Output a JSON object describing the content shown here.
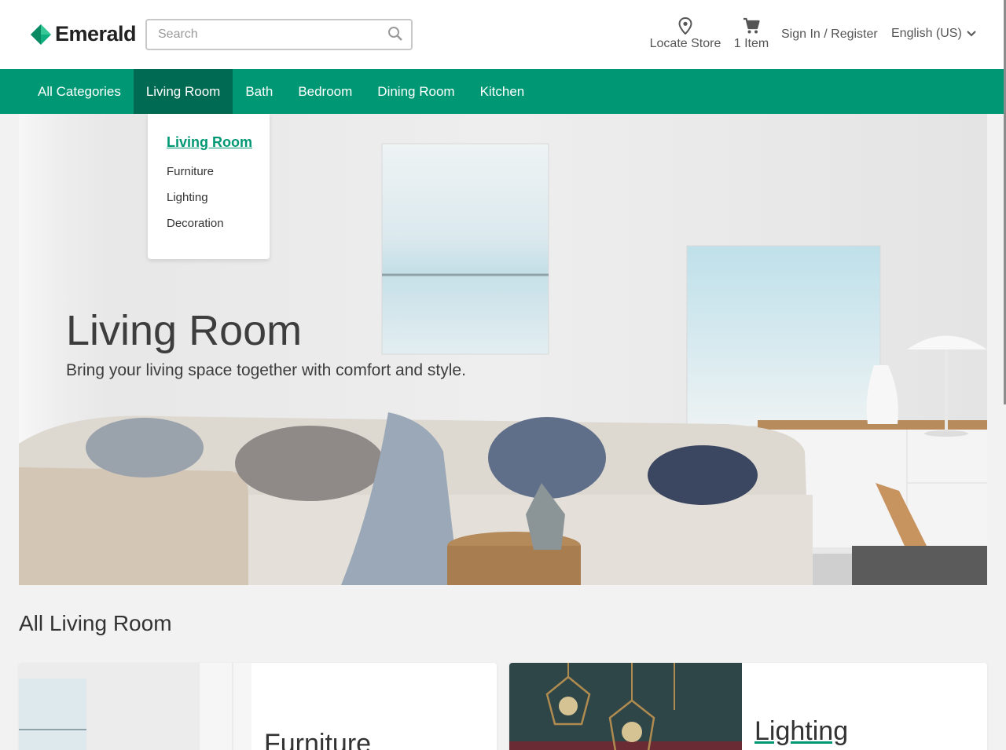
{
  "header": {
    "logo_text": "Emerald",
    "search_placeholder": "Search",
    "locate_label": "Locate Store",
    "cart_label": "1 Item",
    "signin_label": "Sign In / Register",
    "language_label": "English (US)"
  },
  "nav": {
    "items": [
      {
        "label": "All Categories"
      },
      {
        "label": "Living Room"
      },
      {
        "label": "Bath"
      },
      {
        "label": "Bedroom"
      },
      {
        "label": "Dining Room"
      },
      {
        "label": "Kitchen"
      }
    ],
    "active_index": 1
  },
  "dropdown": {
    "heading": "Living Room",
    "items": [
      "Furniture",
      "Lighting",
      "Decoration"
    ]
  },
  "hero": {
    "title": "Living Room",
    "subtitle": "Bring your living space together with comfort and style."
  },
  "section": {
    "title": "All Living Room",
    "cards": [
      {
        "title": "Furniture",
        "icon": "sofa-image"
      },
      {
        "title": "Lighting",
        "icon": "pendant-lamps-image"
      }
    ]
  },
  "colors": {
    "brand": "#009874",
    "nav_active": "#006b52",
    "page_bg": "#f2f2f2"
  }
}
